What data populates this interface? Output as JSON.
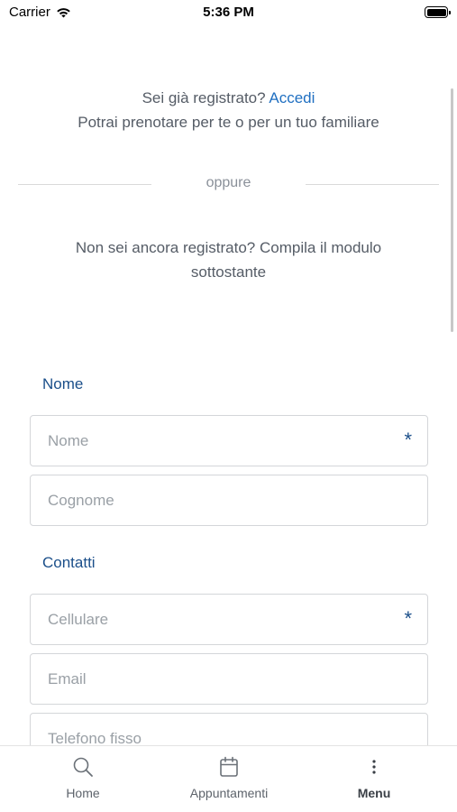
{
  "status_bar": {
    "carrier": "Carrier",
    "time": "5:36 PM"
  },
  "intro": {
    "login_prompt": "Sei già registrato?",
    "login_link": "Accedi",
    "family_text": "Potrai prenotare per te o per un tuo familiare",
    "divider_text": "oppure",
    "register_text": "Non sei ancora registrato? Compila il modulo sottostante"
  },
  "form": {
    "name_section": {
      "title": "Nome",
      "fields": [
        {
          "placeholder": "Nome",
          "required": true
        },
        {
          "placeholder": "Cognome",
          "required": false
        }
      ]
    },
    "contacts_section": {
      "title": "Contatti",
      "fields": [
        {
          "placeholder": "Cellulare",
          "required": true
        },
        {
          "placeholder": "Email",
          "required": false
        },
        {
          "placeholder": "Telefono fisso",
          "required": false
        }
      ]
    },
    "required_marker": "*"
  },
  "tab_bar": {
    "items": [
      {
        "label": "Home",
        "icon": "search-icon",
        "active": false
      },
      {
        "label": "Appuntamenti",
        "icon": "calendar-icon",
        "active": false
      },
      {
        "label": "Menu",
        "icon": "more-vertical-icon",
        "active": true
      }
    ]
  },
  "colors": {
    "link": "#1f6fc1",
    "section_title": "#1b4f8a",
    "text": "#555c66",
    "placeholder": "#9aa0a6"
  }
}
